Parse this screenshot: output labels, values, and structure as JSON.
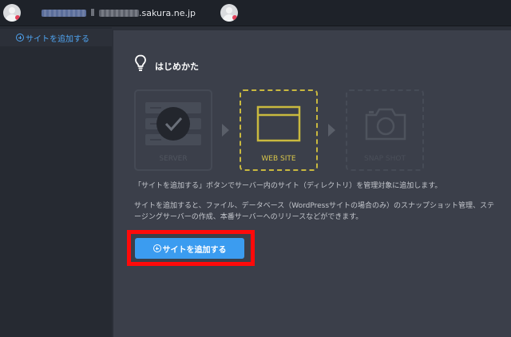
{
  "topbar": {
    "host": ".sakura.ne.jp"
  },
  "sidebar": {
    "items": [
      {
        "label": "サイトを追加する",
        "icon": "plus-circle-icon"
      }
    ]
  },
  "main": {
    "title": "はじめかた",
    "steps": [
      {
        "label": "SERVER",
        "icon": "server-icon"
      },
      {
        "label": "WEB SITE",
        "icon": "browser-window-icon"
      },
      {
        "label": "SNAP SHOT",
        "icon": "camera-icon"
      }
    ],
    "description1": "「サイトを追加する」ボタンでサーバー内のサイト（ディレクトリ）を管理対象に追加します。",
    "description2": "サイトを追加すると、ファイル、データベース（WordPressサイトの場合のみ）のスナップショット管理、ステージングサーバーの作成、本番サーバーへのリリースなどができます。",
    "add_button": "サイトを追加する"
  },
  "colors": {
    "accent": "#3b9cf0",
    "active_step": "#c9b93f",
    "highlight": "#ff0a0a"
  }
}
